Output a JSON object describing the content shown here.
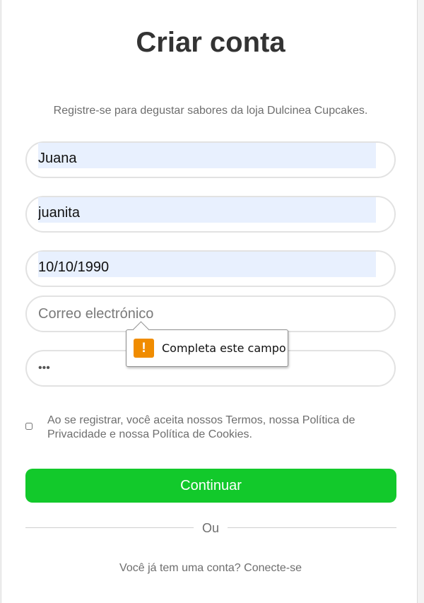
{
  "page": {
    "title": "Criar conta",
    "subtitle": "Registre-se para degustar sabores da loja Dulcinea Cupcakes."
  },
  "form": {
    "name": {
      "value": "Juana"
    },
    "username": {
      "value": "juanita"
    },
    "birthdate": {
      "value": "10/10/1990"
    },
    "email": {
      "placeholder": "Correo electrónico",
      "value": ""
    },
    "password": {
      "value": "•••"
    },
    "terms_text": "Ao se registrar, você aceita nossos Termos, nossa Política de Privacidade e nossa Política de Cookies.",
    "submit_label": "Continuar"
  },
  "validation_tooltip": {
    "icon": "warning-icon",
    "icon_glyph": "!",
    "message": "Completa este campo",
    "color": "#f08c00"
  },
  "divider": {
    "label": "Ou"
  },
  "login": {
    "prompt": "Você já tem uma conta?",
    "link": "Conecte-se"
  },
  "colors": {
    "accent": "#12c92b",
    "autofill": "#e8f0fe",
    "title": "#333333",
    "muted_text": "#6e6e6e"
  }
}
